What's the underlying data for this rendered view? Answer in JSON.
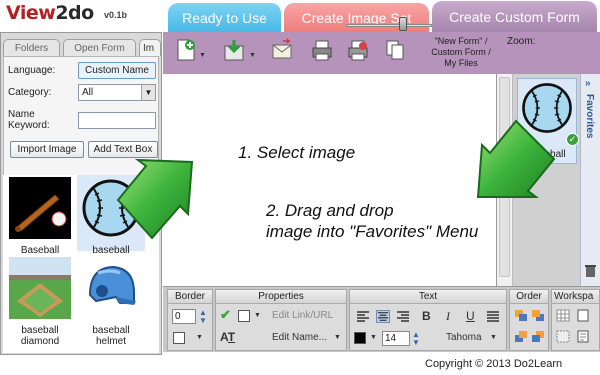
{
  "app": {
    "logo": "View2do",
    "version": "v0.1b"
  },
  "main_tabs": [
    {
      "label": "Ready to Use",
      "color": "#49b8e6"
    },
    {
      "label": "Create Image Set",
      "color": "#ee7d7d"
    },
    {
      "label": "Create Custom Form",
      "color": "#a585ab",
      "active": true
    }
  ],
  "left_panel": {
    "tabs": [
      {
        "label": "Folders"
      },
      {
        "label": "Open Form"
      },
      {
        "label": "Im",
        "active": true
      }
    ],
    "language_label": "Language:",
    "language_button": "Custom Name",
    "category_label": "Category:",
    "category_value": "All",
    "keyword_label_1": "Name",
    "keyword_label_2": "Keyword:",
    "keyword_value": "",
    "import_button": "Import Image",
    "add_text_button": "Add Text Box",
    "images": [
      {
        "caption": "Baseball",
        "icon": "baseball-bat-icon"
      },
      {
        "caption": "baseball",
        "icon": "baseball-icon",
        "selected": true
      },
      {
        "caption_line1": "baseball",
        "caption_line2": "diamond",
        "icon": "baseball-diamond-icon"
      },
      {
        "caption_line1": "baseball",
        "caption_line2": "helmet",
        "icon": "baseball-helmet-icon"
      }
    ]
  },
  "toolbar": {
    "form_path_line1": "\"New Form\" /",
    "form_path_line2": "Custom Form /",
    "form_path_line3": "My Files",
    "zoom_label": "Zoom:",
    "zoom_level": 0.66
  },
  "favorites": {
    "label": "Favorites",
    "item_caption": "baseball"
  },
  "props_bar": {
    "border_label": "Border",
    "border_value": "0",
    "properties_label": "Properties",
    "edit_link": "Edit Link/URL",
    "edit_name": "Edit Name...",
    "text_label": "Text",
    "font_size": "14",
    "font_name": "Tahoma",
    "order_label": "Order",
    "workspace_label": "Workspa"
  },
  "overlay": {
    "instruction_1": "1. Select image",
    "instruction_2_line1": "2. Drag and drop",
    "instruction_2_line2": "image into \"Favorites\" Menu"
  },
  "copyright": "Copyright © 2013 Do2Learn",
  "colors": {
    "toolbar": "#b593bb",
    "arrow_green": "#3cb43c",
    "selected_bg": "#dbe8f7",
    "logo_red": "#b22222"
  }
}
